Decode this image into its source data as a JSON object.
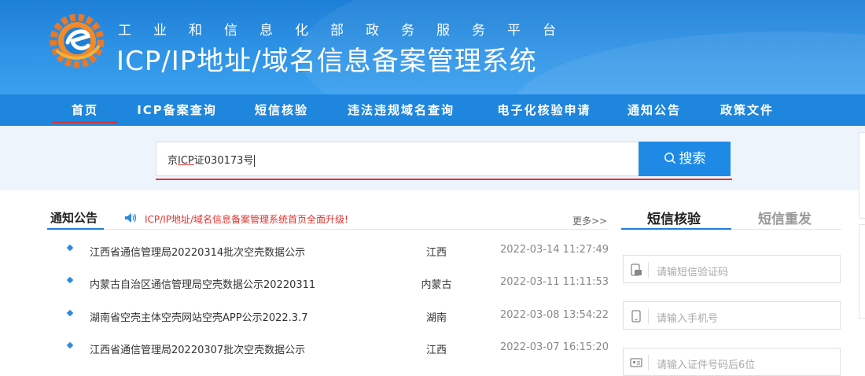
{
  "header": {
    "subtitle": "工业和信息化部政务服务平台",
    "title": "ICP/IP地址/域名信息备案管理系统"
  },
  "nav": {
    "items": [
      {
        "label": "首页",
        "active": true
      },
      {
        "label": "ICP备案查询",
        "active": false
      },
      {
        "label": "短信核验",
        "active": false
      },
      {
        "label": "违法违规域名查询",
        "active": false
      },
      {
        "label": "电子化核验申请",
        "active": false
      },
      {
        "label": "通知公告",
        "active": false
      },
      {
        "label": "政策文件",
        "active": false
      }
    ]
  },
  "search": {
    "value_prefix": "京",
    "value_underlined": "ICP",
    "value_suffix": "证030173号",
    "button_label": "搜索"
  },
  "notices": {
    "title": "通知公告",
    "marquee": "ICP/IP地址/域名信息备案管理系统首页全面升级!",
    "more": "更多>>",
    "rows": [
      {
        "text": "江西省通信管理局20220314批次空壳数据公示",
        "province": "江西",
        "time": "2022-03-14 11:27:49"
      },
      {
        "text": "内蒙古自治区通信管理局空壳数据公示20220311",
        "province": "内蒙古",
        "time": "2022-03-11 11:11:53"
      },
      {
        "text": "湖南省空壳主体空壳网站空壳APP公示2022.3.7",
        "province": "湖南",
        "time": "2022-03-08 13:54:22"
      },
      {
        "text": "江西省通信管理局20220307批次空壳数据公示",
        "province": "江西",
        "time": "2022-03-07 16:15:20"
      }
    ]
  },
  "sms_panel": {
    "tab_verify": "短信核验",
    "tab_resend": "短信重发",
    "code_placeholder": "请输短信验证码",
    "phone_placeholder": "请输入手机号",
    "id_placeholder": "请输入证件号码后6位"
  },
  "colors": {
    "header_blue": "#1d7fd7",
    "nav_blue": "#1f86de",
    "accent_red": "#e3342f",
    "button_blue": "#1e8ae6"
  }
}
